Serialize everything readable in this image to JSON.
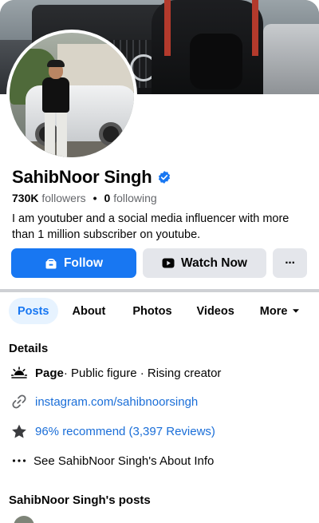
{
  "profile": {
    "name": "SahibNoor Singh",
    "followers_count": "730K",
    "followers_label": "followers",
    "following_count": "0",
    "following_label": "following",
    "bio": "I am youtuber and a social media influencer with more than 1 million subscriber on youtube."
  },
  "actions": {
    "follow_label": "Follow",
    "watch_label": "Watch Now",
    "more_label": "···"
  },
  "tabs": [
    {
      "label": "Posts",
      "active": true
    },
    {
      "label": "About",
      "active": false
    },
    {
      "label": "Photos",
      "active": false
    },
    {
      "label": "Videos",
      "active": false
    },
    {
      "label": "More",
      "active": false
    }
  ],
  "details": {
    "title": "Details",
    "page_label": "Page",
    "page_category": " · Public figure · Rising creator",
    "instagram": "instagram.com/sahibnoorsingh",
    "recommend": "96% recommend (3,397 Reviews)",
    "about_info": "See SahibNoor Singh's About Info"
  },
  "posts_section": {
    "title": "SahibNoor Singh's posts"
  },
  "colors": {
    "accent": "#1877f2",
    "button_gray": "#e4e6eb",
    "link": "#1a6ed8",
    "tab_active_bg": "#e7f3ff"
  },
  "icons": [
    "verified-badge-icon",
    "follow-icon",
    "play-icon",
    "more-dots-icon",
    "chevron-down-icon",
    "page-icon",
    "link-icon",
    "star-icon",
    "ellipsis-icon"
  ]
}
